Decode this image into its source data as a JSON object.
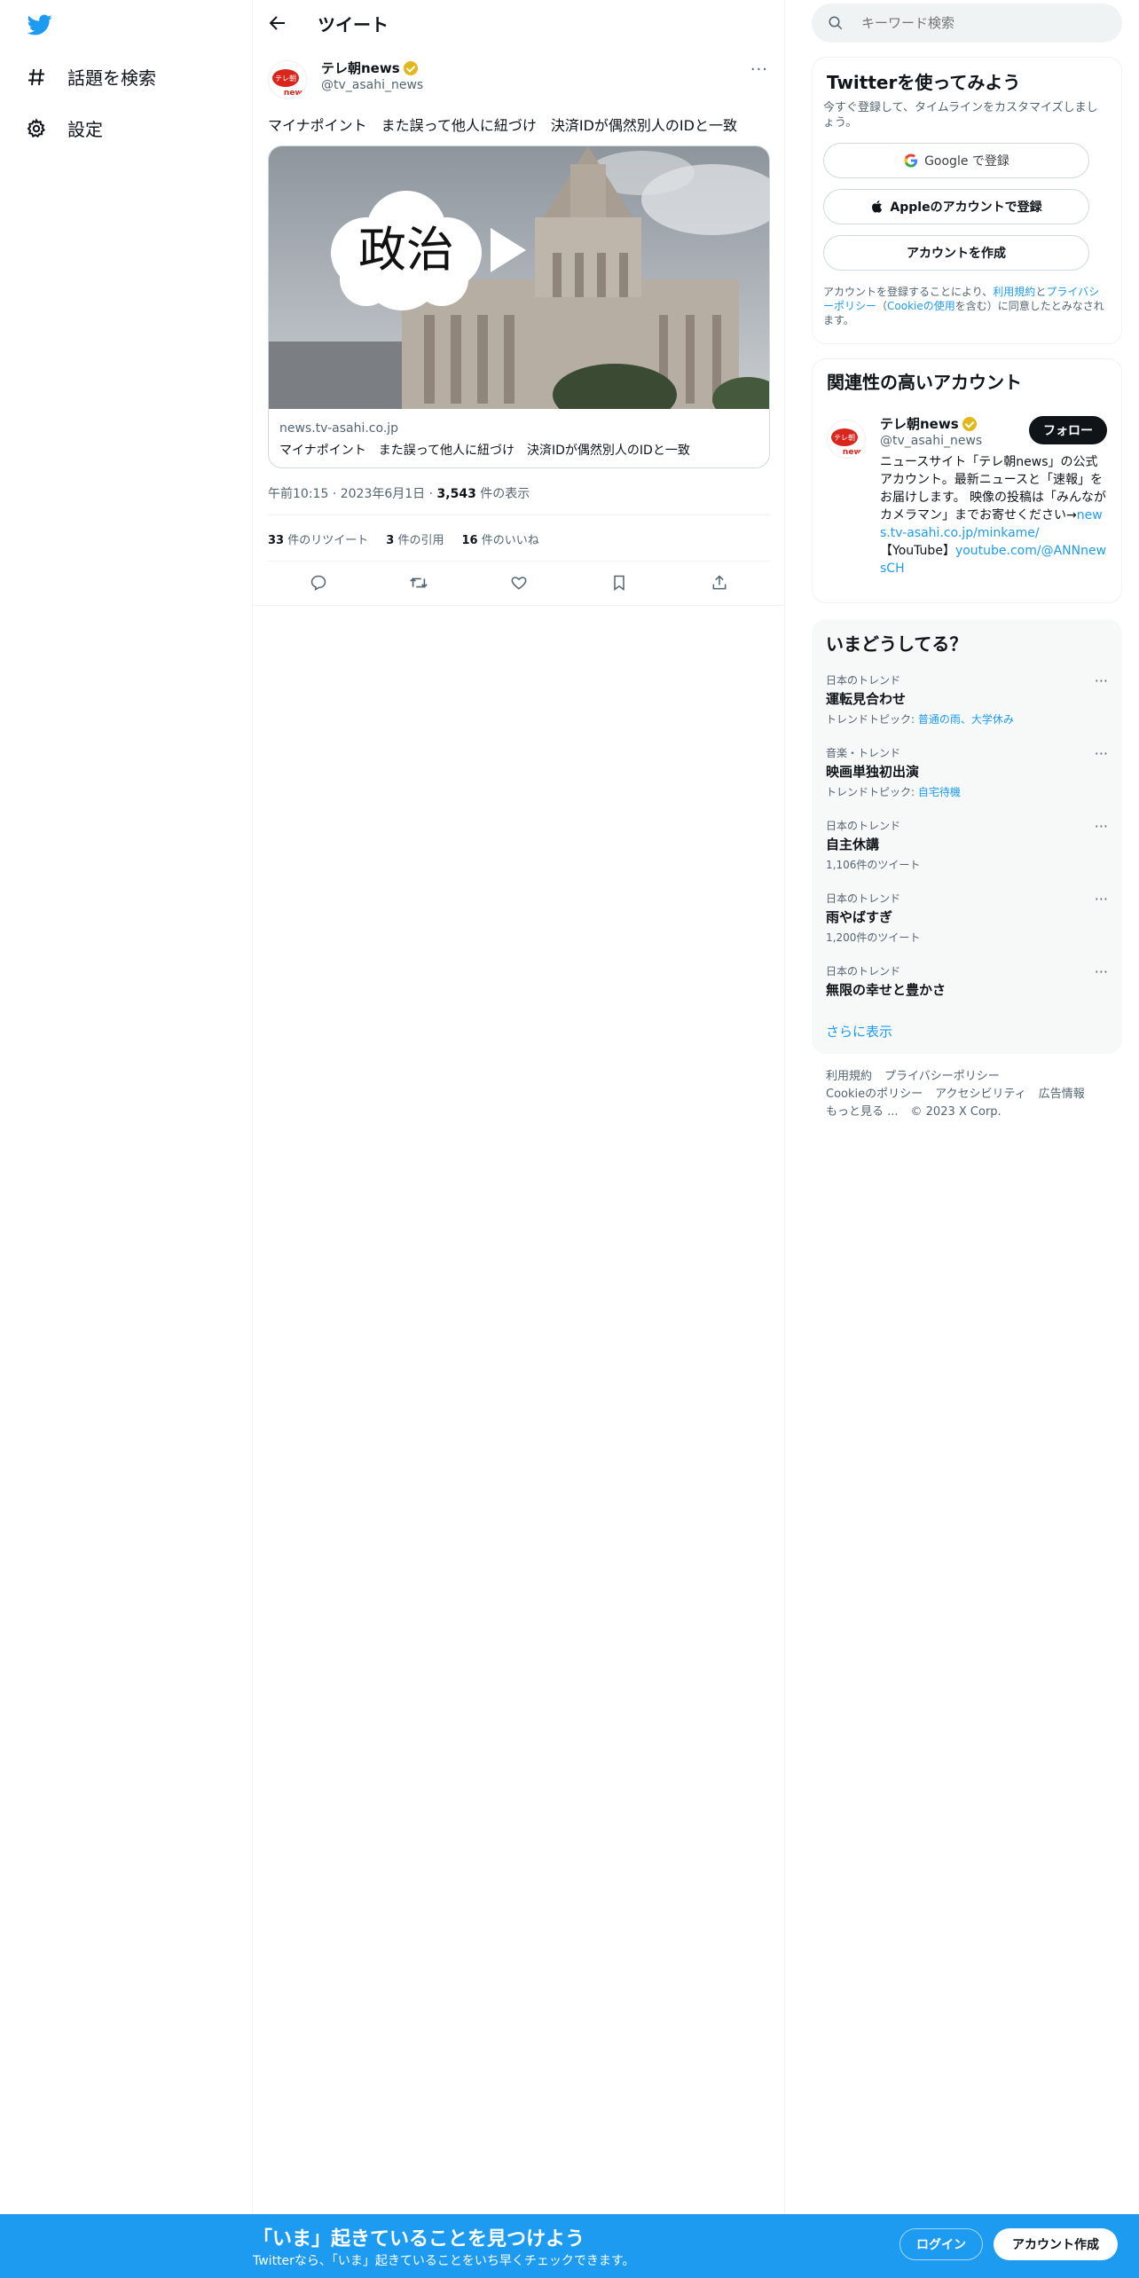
{
  "sidebar": {
    "items": [
      {
        "label": "話題を検索",
        "icon": "hashtag-icon"
      },
      {
        "label": "設定",
        "icon": "gear-icon"
      }
    ]
  },
  "header": {
    "title": "ツイート"
  },
  "tweet": {
    "author_name": "テレ朝news",
    "author_handle": "@tv_asahi_news",
    "avatar_text_top": "テレ朝",
    "avatar_text_bottom": "news",
    "text": "マイナポイント　また誤って他人に紐づけ　決済IDが偶然別人のIDと一致",
    "card": {
      "image_label": "政治",
      "domain": "news.tv-asahi.co.jp",
      "title": "マイナポイント　また誤って他人に紐づけ　決済IDが偶然別人のIDと一致"
    },
    "time": "午前10:15",
    "date": "2023年6月1日",
    "views_count": "3,543",
    "views_label": "件の表示",
    "retweets_count": "33",
    "retweets_label": "件のリツイート",
    "quotes_count": "3",
    "quotes_label": "件の引用",
    "likes_count": "16",
    "likes_label": "件のいいね"
  },
  "search": {
    "placeholder": "キーワード検索"
  },
  "signup": {
    "title": "Twitterを使ってみよう",
    "subtitle": "今すぐ登録して、タイムラインをカスタマイズしましょう。",
    "google_label": "Google で登録",
    "apple_label": "Appleのアカウントで登録",
    "create_label": "アカウントを作成",
    "terms_prefix": "アカウントを登録することにより、",
    "terms_link1": "利用規約",
    "terms_mid": "と",
    "terms_link2": "プライバシーポリシー",
    "terms_mid2": "（",
    "terms_link3": "Cookieの使用",
    "terms_suffix": "を含む）に同意したとみなされます。"
  },
  "related": {
    "title": "関連性の高いアカウント",
    "name": "テレ朝news",
    "handle": "@tv_asahi_news",
    "follow_label": "フォロー",
    "bio_text": "ニュースサイト「テレ朝news」の公式アカウント。最新ニュースと「速報」をお届けします。 映像の投稿は「みんながカメラマン」までお寄せください→",
    "bio_link1": "news.tv-asahi.co.jp/minkame/",
    "bio_text2": "【YouTube】",
    "bio_link2": "youtube.com/@ANNnewsCH"
  },
  "trends": {
    "title": "いまどうしてる？",
    "items": [
      {
        "category": "日本のトレンド",
        "name": "運転見合わせ",
        "sub_prefix": "トレンドトピック: ",
        "sub_link": "普通の雨、大学休み",
        "sub": ""
      },
      {
        "category": "音楽・トレンド",
        "name": "映画単独初出演",
        "sub_prefix": "トレンドトピック: ",
        "sub_link": "自宅待機",
        "sub": ""
      },
      {
        "category": "日本のトレンド",
        "name": "自主休講",
        "sub_prefix": "",
        "sub_link": "",
        "sub": "1,106件のツイート"
      },
      {
        "category": "日本のトレンド",
        "name": "雨やばすぎ",
        "sub_prefix": "",
        "sub_link": "",
        "sub": "1,200件のツイート"
      },
      {
        "category": "日本のトレンド",
        "name": "無限の幸せと豊かさ",
        "sub_prefix": "",
        "sub_link": "",
        "sub": ""
      }
    ],
    "show_more": "さらに表示"
  },
  "footer": {
    "links": [
      "利用規約",
      "プライバシーポリシー",
      "Cookieのポリシー",
      "アクセシビリティ",
      "広告情報",
      "もっと見る ...",
      "© 2023 X Corp."
    ]
  },
  "banner": {
    "title": "「いま」起きていることを見つけよう",
    "subtitle": "Twitterなら、「いま」起きていることをいち早くチェックできます。",
    "login_label": "ログイン",
    "signup_label": "アカウント作成"
  },
  "colors": {
    "accent": "#1d9bf0",
    "text": "#0f1419",
    "muted": "#536471",
    "verified": "#e2b719"
  }
}
